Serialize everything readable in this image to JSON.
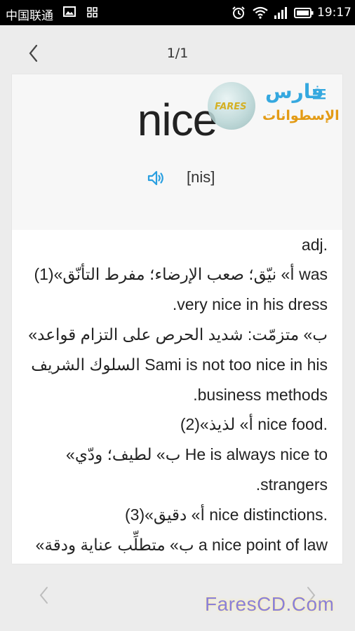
{
  "status_bar": {
    "carrier": "中国联通",
    "time": "19:17"
  },
  "nav": {
    "page_indicator": "1/1"
  },
  "entry": {
    "headword": "nice",
    "phonetic": "[nis]",
    "definition_lines": [
      "adj.",
      "(1)«أ» نيّق؛ صعب الإرضاء؛ مفرط التأنّق was",
      ".very nice in his dress",
      "«ب» متزمّت: شديد الحرص على التزام قواعد",
      "السلوك الشريف Sami is not too nice in his",
      ".business methods",
      "(2)«أ» لذيذ nice food.",
      "«ب» لطيف؛ ودّي He is always nice to",
      ".strangers",
      "(3)«أ» دقيق nice distinctions.",
      "«ب» متطلِّب عناية ودقة a nice point of law"
    ]
  },
  "watermark": {
    "logo_arabic_top": "فارس",
    "logo_arabic_bottom": "الإسطوانات",
    "logo_circle": "FARES",
    "footer": "FaresCD.Com"
  },
  "icons": {
    "back": "chevron-left-icon",
    "speaker": "speaker-icon",
    "prev": "chevron-left-icon",
    "next": "chevron-right-icon"
  },
  "colors": {
    "accent": "#35a8df",
    "card_head_bg": "#f7f7f7",
    "page_bg": "#ececec"
  }
}
